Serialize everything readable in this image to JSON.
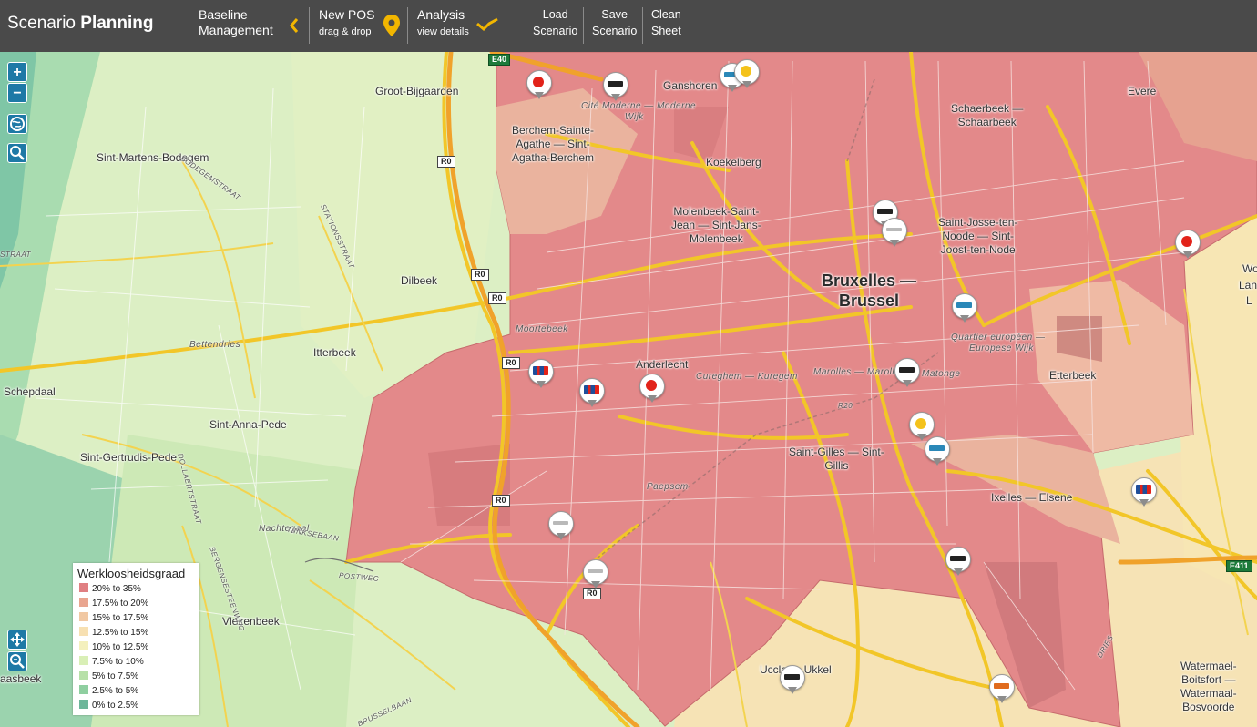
{
  "app": {
    "title_light": "Scenario",
    "title_bold": "Planning"
  },
  "nav": {
    "baseline_line1": "Baseline",
    "baseline_line2": "Management",
    "newpos_main": "New POS",
    "newpos_sub": "drag & drop",
    "analysis_main": "Analysis",
    "analysis_sub": "view details"
  },
  "buttons": {
    "load_line1": "Load",
    "load_line2": "Scenario",
    "save_line1": "Save",
    "save_line2": "Scenario",
    "clean_line1": "Clean",
    "clean_line2": "Sheet"
  },
  "map_controls": {
    "zoom_in": "+",
    "zoom_out": "−"
  },
  "places": {
    "groot_bijgaarden": "Groot-Bijgaarden",
    "ganshoren": "Ganshoren",
    "evere": "Evere",
    "cite_moderne": "Cité Moderne — Moderne",
    "wijk": "Wijk",
    "berchem_1": "Berchem-Sainte-",
    "berchem_2": "Agathe — Sint-",
    "berchem_3": "Agatha-Berchem",
    "koekelberg": "Koekelberg",
    "schaerbeek_1": "Schaerbeek —",
    "schaerbeek_2": "Schaarbeek",
    "sint_martens": "Sint-Martens-Bodegem",
    "molenbeek_1": "Molenbeek-Saint-",
    "molenbeek_2": "Jean — Sint-Jans-",
    "molenbeek_3": "Molenbeek",
    "sint_josse_1": "Saint-Josse-ten-",
    "sint_josse_2": "Noode — Sint-",
    "sint_josse_3": "Joost-ten-Node",
    "bruxelles_1": "Bruxelles —",
    "bruxelles_2": "Brussel",
    "dilbeek": "Dilbeek",
    "moortebeek": "Moortebeek",
    "bettendries": "Bettendries",
    "itterbeek": "Itterbeek",
    "quartier_1": "Quartier européen —",
    "quartier_2": "Europese Wijk",
    "anderlecht": "Anderlecht",
    "schepdaal": "Schepdaal",
    "cureghem": "Cureghem — Kuregem",
    "marolles": "Marolles — Marollen",
    "matonge": "Matonge",
    "etterbeek": "Etterbeek",
    "sint_anna": "Sint-Anna-Pede",
    "sint_gertrudis": "Sint-Gertrudis-Pede",
    "saint_gilles_1": "Saint-Gilles — Sint-",
    "saint_gilles_2": "Gillis",
    "paepsem": "Paepsem",
    "ixelles": "Ixelles — Elsene",
    "nachtegaal": "Nachtegaal",
    "vlezenbeek": "Vlezenbeek",
    "uccle": "Uccle — Ukkel",
    "watermael_1": "Watermael-",
    "watermael_2": "Boitsfort —",
    "watermael_3": "Watermaal-",
    "watermael_4": "Bosvoorde",
    "woluwe_1": "Wo",
    "woluwe_2": "Lan",
    "woluwe_3": "L",
    "aasbeek": "aasbeek"
  },
  "streets": {
    "bodegemstraat": "BODEGEMSTRAAT",
    "stationsstraat": "STATIONSSTRAAT",
    "dollaertstraat": "DOLLAERTSTRAAT",
    "ninkebaan": "NINKSEBAAN",
    "postweg": "POSTWEG",
    "bergensesteenweg": "BERGENSESTEENWEG",
    "brusselbaan": "BRUSSELBAAN",
    "drieskensstraat": "DRIES",
    "r20": "R20",
    "straat": "STRAAT"
  },
  "road_shields": {
    "e40": "E40",
    "r0_1": "R0",
    "r0_2": "R0",
    "r0_3": "R0",
    "r0_4": "R0",
    "r0_5": "R0",
    "r0_6": "R0",
    "e411": "E411"
  },
  "legend": {
    "title": "Werkloosheidsgraad",
    "items": [
      {
        "label": "20% to 35%",
        "color": "#e07f82"
      },
      {
        "label": "17.5% to 20%",
        "color": "#e9a58f"
      },
      {
        "label": "15% to 17.5%",
        "color": "#f1c8a3"
      },
      {
        "label": "12.5% to 15%",
        "color": "#f7e0b2"
      },
      {
        "label": "10% to 12.5%",
        "color": "#f4f0bd"
      },
      {
        "label": "7.5% to 10%",
        "color": "#d9efb6"
      },
      {
        "label": "5% to 7.5%",
        "color": "#b7e0a8"
      },
      {
        "label": "2.5% to 5%",
        "color": "#8fcfa0"
      },
      {
        "label": "0% to 2.5%",
        "color": "#6db69a"
      }
    ]
  },
  "colors": {
    "topbar": "#4a4a4a",
    "accent": "#f2b600",
    "control_blue": "#1e79a6"
  },
  "pins": [
    {
      "brand": "brand-red"
    },
    {
      "brand": "brand-black"
    },
    {
      "brand": "brand-teal"
    },
    {
      "brand": "brand-yellow"
    },
    {
      "brand": "brand-black"
    },
    {
      "brand": "brand-grey"
    },
    {
      "brand": "brand-blue"
    },
    {
      "brand": "brand-blue"
    },
    {
      "brand": "brand-red"
    },
    {
      "brand": "brand-teal"
    },
    {
      "brand": "brand-black"
    },
    {
      "brand": "brand-yellow"
    },
    {
      "brand": "brand-red"
    },
    {
      "brand": "brand-grey"
    },
    {
      "brand": "brand-black"
    },
    {
      "brand": "brand-blue"
    },
    {
      "brand": "brand-orange"
    },
    {
      "brand": "brand-black"
    },
    {
      "brand": "brand-teal"
    },
    {
      "brand": "brand-grey"
    }
  ]
}
